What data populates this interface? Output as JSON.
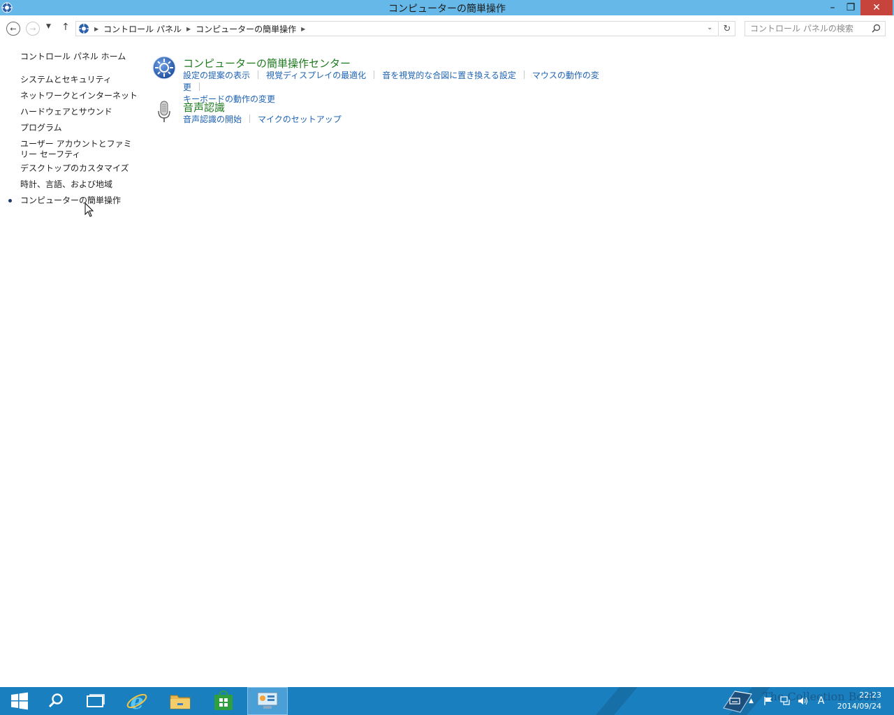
{
  "window": {
    "title": "コンピューターの簡単操作",
    "minimize_glyph": "–",
    "maximize_glyph": "❐",
    "close_glyph": "✕"
  },
  "address_bar": {
    "breadcrumbs": [
      "コントロール パネル",
      "コンピューターの簡単操作"
    ],
    "search_placeholder": "コントロール パネルの検索"
  },
  "sidebar": {
    "home": "コントロール パネル ホーム",
    "items": [
      "システムとセキュリティ",
      "ネットワークとインターネット",
      "ハードウェアとサウンド",
      "プログラム",
      "ユーザー アカウントとファミリー セーフティ",
      "デスクトップのカスタマイズ",
      "時計、言語、および地域",
      "コンピューターの簡単操作"
    ]
  },
  "categories": [
    {
      "title": "コンピューターの簡単操作センター",
      "links": [
        "設定の提案の表示",
        "視覚ディスプレイの最適化",
        "音を視覚的な合図に置き換える設定",
        "マウスの動作の変更",
        "キーボードの動作の変更"
      ]
    },
    {
      "title": "音声認識",
      "links": [
        "音声認識の開始",
        "マイクのセットアップ"
      ]
    }
  ],
  "taskbar": {
    "time": "22:23",
    "date": "2014/09/24",
    "ime_indicator": "A",
    "watermark": "The Collection Book"
  },
  "colors": {
    "titlebar": "#66b8e8",
    "close_button": "#c7443c",
    "category_title": "#1e7a1e",
    "link": "#1d62b3",
    "taskbar": "#1a7fbf"
  }
}
